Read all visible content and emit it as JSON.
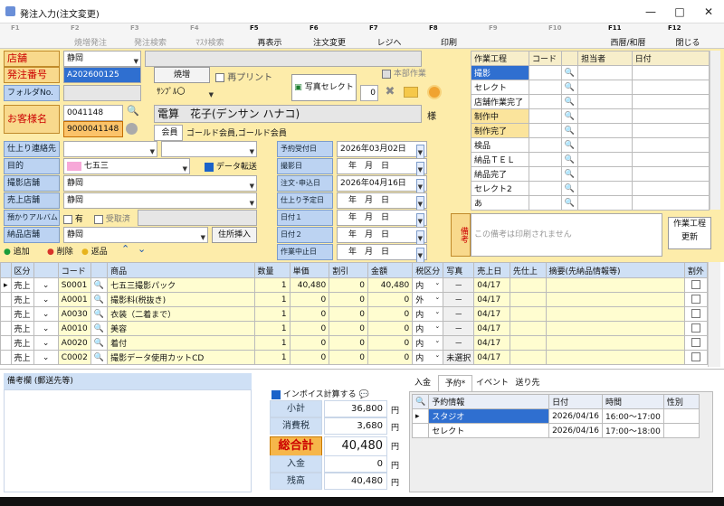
{
  "window": {
    "title": "発注入力(注文変更)"
  },
  "fkeys": [
    {
      "n": "F1",
      "l": "",
      "dis": true
    },
    {
      "n": "F2",
      "l": "焼増発注",
      "dis": true
    },
    {
      "n": "F3",
      "l": "発注検索",
      "dis": true
    },
    {
      "n": "F4",
      "l": "ﾏｽﾀ検索",
      "dis": true
    },
    {
      "n": "F5",
      "l": "再表示",
      "dis": false
    },
    {
      "n": "F6",
      "l": "注文変更",
      "dis": false
    },
    {
      "n": "F7",
      "l": "レジへ",
      "dis": false
    },
    {
      "n": "F8",
      "l": "印刷",
      "dis": false
    },
    {
      "n": "F9",
      "l": "",
      "dis": true
    },
    {
      "n": "F10",
      "l": "",
      "dis": true
    },
    {
      "n": "F11",
      "l": "西暦/和暦",
      "dis": false
    },
    {
      "n": "F12",
      "l": "閉じる",
      "dis": false
    }
  ],
  "form": {
    "store_label": "店舗",
    "store_value": "静岡",
    "order_no_label": "発注番号",
    "order_no_value": "A202600125",
    "folder_label": "フォルダNo.",
    "customer_label": "お客様名",
    "customer_code": "0041148",
    "customer_code2": "9000041148",
    "reprint_btn": "焼増",
    "reprint_chk": "再プリント",
    "sample_value": "ｻﾝﾌﾟﾙ〇",
    "photo_select": "写真セレクト",
    "photo_count": "0",
    "honbu_label": "本部作業",
    "customer_name": "電算　花子(デンサン ハナコ)",
    "sama": "様",
    "member_label": "会員",
    "member_value": "ゴールド会員,ゴールド会員",
    "finish_contact_label": "仕上り連絡先",
    "purpose_label": "目的",
    "purpose_value": "七五三",
    "shoot_store_label": "撮影店舗",
    "shoot_store_value": "静岡",
    "sales_store_label": "売上店舗",
    "sales_store_value": "静岡",
    "album_label": "預かりアルバム",
    "album_yes": "有",
    "album_received": "受取済",
    "delivery_store_label": "納品店舗",
    "delivery_store_value": "静岡",
    "data_transfer": "データ転送",
    "addr_btn": "住所挿入",
    "add_btn": "追加",
    "del_btn": "削除",
    "return_btn": "返品"
  },
  "dates": [
    {
      "label": "予約受付日",
      "value": "2026年03月02日"
    },
    {
      "label": "撮影日",
      "value": "　年　月　日"
    },
    {
      "label": "注文･申込日",
      "value": "2026年04月16日"
    },
    {
      "label": "仕上り予定日",
      "value": "　年　月　日"
    },
    {
      "label": "日付１",
      "value": "　年　月　日"
    },
    {
      "label": "日付２",
      "value": "　年　月　日"
    },
    {
      "label": "作業中止日",
      "value": "　年　月　日"
    }
  ],
  "process": {
    "headers": [
      "作業工程",
      "コード",
      "",
      "担当者",
      "日付"
    ],
    "rows": [
      {
        "name": "撮影",
        "sel": true
      },
      {
        "name": "セレクト"
      },
      {
        "name": "店舗作業完了"
      },
      {
        "name": "制作中",
        "hl": true
      },
      {
        "name": "制作完了",
        "hl": true
      },
      {
        "name": "検品"
      },
      {
        "name": "納品ＴＥＬ"
      },
      {
        "name": "納品完了"
      },
      {
        "name": "セレクト2"
      },
      {
        "name": "あ"
      }
    ],
    "memo_label": "備考",
    "memo_placeholder": "この備考は印刷されません",
    "update_btn": "作業工程\n更新"
  },
  "items": {
    "headers": [
      "",
      "区分",
      "",
      "コード",
      "",
      "商品",
      "数量",
      "単価",
      "割引",
      "金額",
      "税区分",
      "写真",
      "売上日",
      "先仕上",
      "摘要(先納品情報等)",
      "割外"
    ],
    "rows": [
      {
        "kbn": "売上",
        "code": "S0001",
        "name": "七五三撮影パック",
        "qty": "1",
        "price": "40,480",
        "disc": "0",
        "amt": "40,480",
        "tax": "内",
        "photo": "－",
        "date": "04/17"
      },
      {
        "kbn": "売上",
        "code": "A0001",
        "name": "撮影料(税抜き)",
        "qty": "1",
        "price": "0",
        "disc": "0",
        "amt": "0",
        "tax": "外",
        "photo": "－",
        "date": "04/17"
      },
      {
        "kbn": "売上",
        "code": "A0030",
        "name": "衣装（二着まで）",
        "qty": "1",
        "price": "0",
        "disc": "0",
        "amt": "0",
        "tax": "内",
        "photo": "－",
        "date": "04/17"
      },
      {
        "kbn": "売上",
        "code": "A0010",
        "name": "美容",
        "qty": "1",
        "price": "0",
        "disc": "0",
        "amt": "0",
        "tax": "内",
        "photo": "－",
        "date": "04/17"
      },
      {
        "kbn": "売上",
        "code": "A0020",
        "name": "着付",
        "qty": "1",
        "price": "0",
        "disc": "0",
        "amt": "0",
        "tax": "内",
        "photo": "－",
        "date": "04/17"
      },
      {
        "kbn": "売上",
        "code": "C0002",
        "name": "撮影データ使用カットCD",
        "qty": "1",
        "price": "0",
        "disc": "0",
        "amt": "0",
        "tax": "内",
        "photo": "未選択",
        "date": "04/17"
      }
    ]
  },
  "bottom": {
    "memo_label": "備考欄 (郵送先等)",
    "invoice_label": "インボイス計算する",
    "totals": [
      {
        "label": "小計",
        "value": "36,800",
        "unit": "円"
      },
      {
        "label": "消費税",
        "value": "3,680",
        "unit": "円"
      },
      {
        "label": "総合計",
        "value": "40,480",
        "unit": "円",
        "grand": true
      },
      {
        "label": "入金",
        "value": "0",
        "unit": "円"
      },
      {
        "label": "残高",
        "value": "40,480",
        "unit": "円"
      }
    ],
    "tabs": [
      "入金",
      "予約*",
      "イベント",
      "送り先"
    ],
    "reserve_headers": [
      "",
      "予約情報",
      "日付",
      "時間",
      "性別"
    ],
    "reserve_rows": [
      {
        "name": "スタジオ",
        "date": "2026/04/16",
        "time": "16:00～17:00",
        "sel": true
      },
      {
        "name": "セレクト",
        "date": "2026/04/16",
        "time": "17:00～18:00"
      }
    ]
  }
}
